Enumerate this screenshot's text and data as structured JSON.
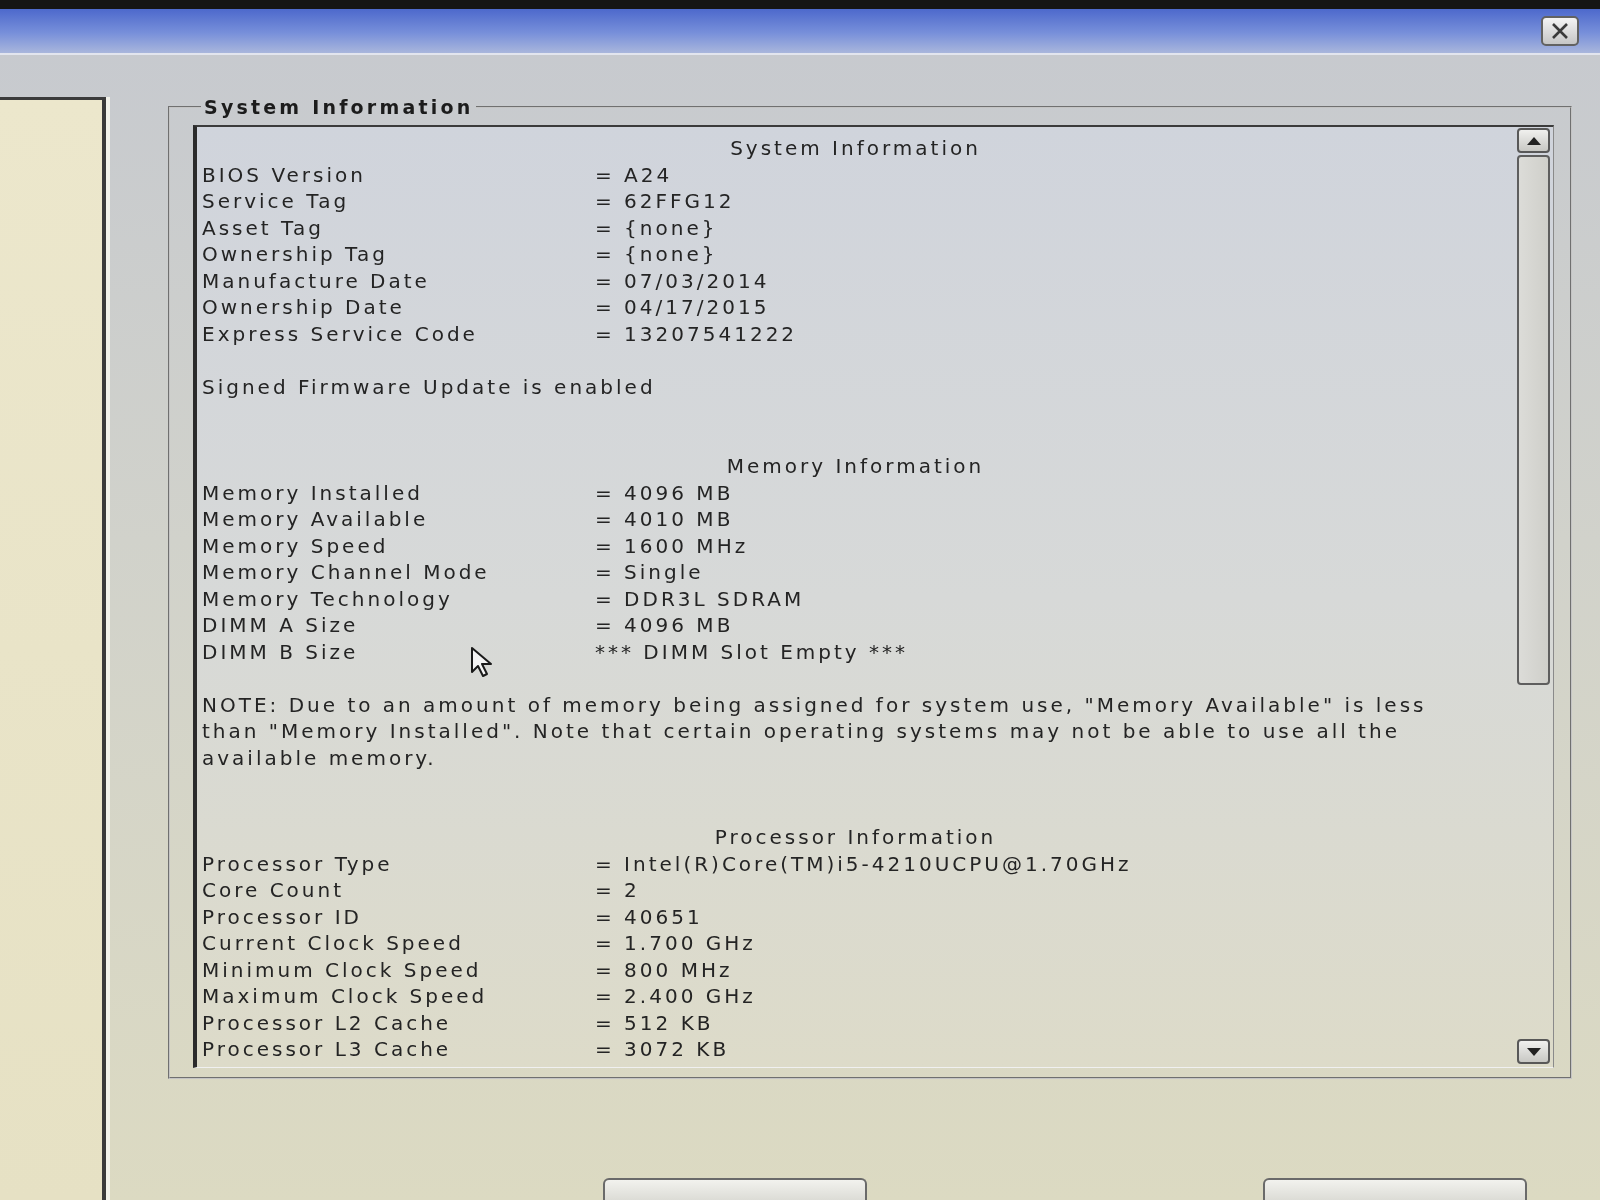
{
  "group_box": {
    "title": "System Information",
    "sections": [
      {
        "heading": "System Information",
        "rows": [
          {
            "label": "BIOS Version",
            "value": "= A24"
          },
          {
            "label": "Service Tag",
            "value": "= 62FFG12"
          },
          {
            "label": "Asset Tag",
            "value": "= {none}"
          },
          {
            "label": "Ownership Tag",
            "value": "= {none}"
          },
          {
            "label": "Manufacture Date",
            "value": "= 07/03/2014"
          },
          {
            "label": "Ownership Date",
            "value": "= 04/17/2015"
          },
          {
            "label": "Express Service Code",
            "value": "= 13207541222"
          }
        ],
        "note": "Signed Firmware Update is enabled"
      },
      {
        "heading": "Memory Information",
        "rows": [
          {
            "label": "Memory Installed",
            "value": "= 4096 MB"
          },
          {
            "label": "Memory Available",
            "value": "= 4010 MB"
          },
          {
            "label": "Memory Speed",
            "value": "= 1600 MHz"
          },
          {
            "label": "Memory Channel Mode",
            "value": "= Single"
          },
          {
            "label": "Memory Technology",
            "value": "= DDR3L SDRAM"
          },
          {
            "label": "DIMM A Size",
            "value": "= 4096 MB"
          },
          {
            "label": "DIMM B Size",
            "value": "*** DIMM Slot Empty ***"
          }
        ],
        "note": "NOTE: Due to an amount of memory being assigned for system use, \"Memory Available\" is less than \"Memory Installed\". Note that certain operating systems may not be able to use all the available memory."
      },
      {
        "heading": "Processor Information",
        "rows": [
          {
            "label": "Processor Type",
            "value": "= Intel(R)Core(TM)i5-4210UCPU@1.70GHz"
          },
          {
            "label": "Core Count",
            "value": "= 2"
          },
          {
            "label": "Processor ID",
            "value": "= 40651"
          },
          {
            "label": "Current Clock Speed",
            "value": "= 1.700 GHz"
          },
          {
            "label": "Minimum Clock Speed",
            "value": "= 800 MHz"
          },
          {
            "label": "Maximum Clock Speed",
            "value": "= 2.400 GHz"
          },
          {
            "label": "Processor L2 Cache",
            "value": "= 512 KB"
          },
          {
            "label": "Processor L3 Cache",
            "value": "= 3072 KB"
          }
        ]
      }
    ]
  }
}
